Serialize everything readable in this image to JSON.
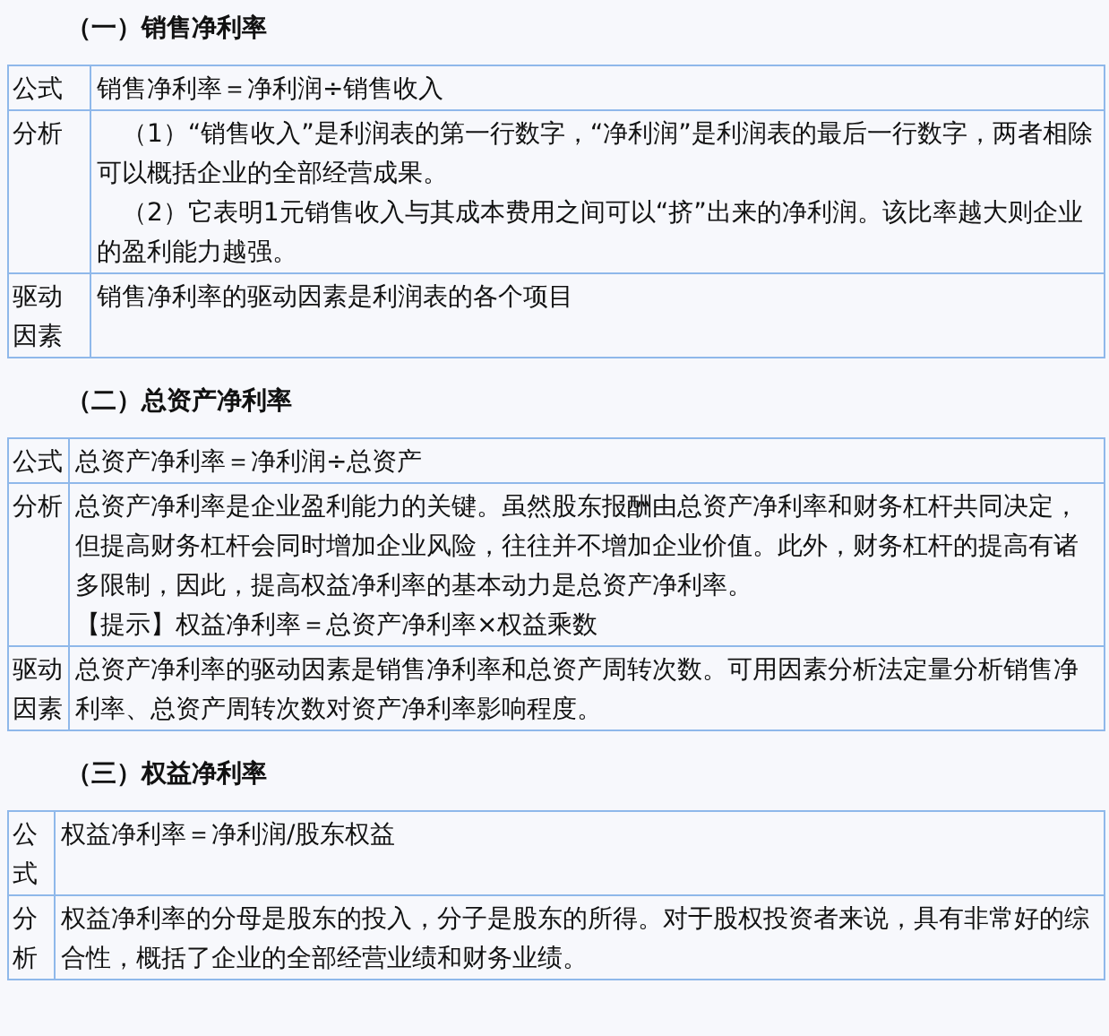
{
  "sections": [
    {
      "heading": "（一）销售净利率",
      "rows": [
        {
          "label": "公式",
          "paragraphs": [
            "销售净利率＝净利润÷销售收入"
          ]
        },
        {
          "label": "分析",
          "paragraphs": [
            "（1）“销售收入”是利润表的第一行数字，“净利润”是利润表的最后一行数字，两者相除可以概括企业的全部经营成果。",
            "（2）它表明1元销售收入与其成本费用之间可以“挤”出来的净利润。该比率越大则企业的盈利能力越强。"
          ]
        },
        {
          "label": "驱动因素",
          "paragraphs": [
            "销售净利率的驱动因素是利润表的各个项目"
          ]
        }
      ]
    },
    {
      "heading": "（二）总资产净利率",
      "rows": [
        {
          "label": "公式",
          "paragraphs": [
            "总资产净利率＝净利润÷总资产"
          ]
        },
        {
          "label": "分析",
          "paragraphs": [
            "总资产净利率是企业盈利能力的关键。虽然股东报酬由总资产净利率和财务杠杆共同决定，但提高财务杠杆会同时增加企业风险，往往并不增加企业价值。此外，财务杠杆的提高有诸多限制，因此，提高权益净利率的基本动力是总资产净利率。",
            "【提示】权益净利率＝总资产净利率×权益乘数"
          ]
        },
        {
          "label": "驱动因素",
          "paragraphs": [
            "总资产净利率的驱动因素是销售净利率和总资产周转次数。可用因素分析法定量分析销售净利率、总资产周转次数对资产净利率影响程度。"
          ]
        }
      ]
    },
    {
      "heading": "（三）权益净利率",
      "rows": [
        {
          "label": "公式",
          "paragraphs": [
            "权益净利率＝净利润/股东权益"
          ]
        },
        {
          "label": "分析",
          "paragraphs": [
            "权益净利率的分母是股东的投入，分子是股东的所得。对于股权投资者来说，具有非常好的综合性，概括了企业的全部经营业绩和财务业绩。"
          ]
        }
      ]
    }
  ]
}
